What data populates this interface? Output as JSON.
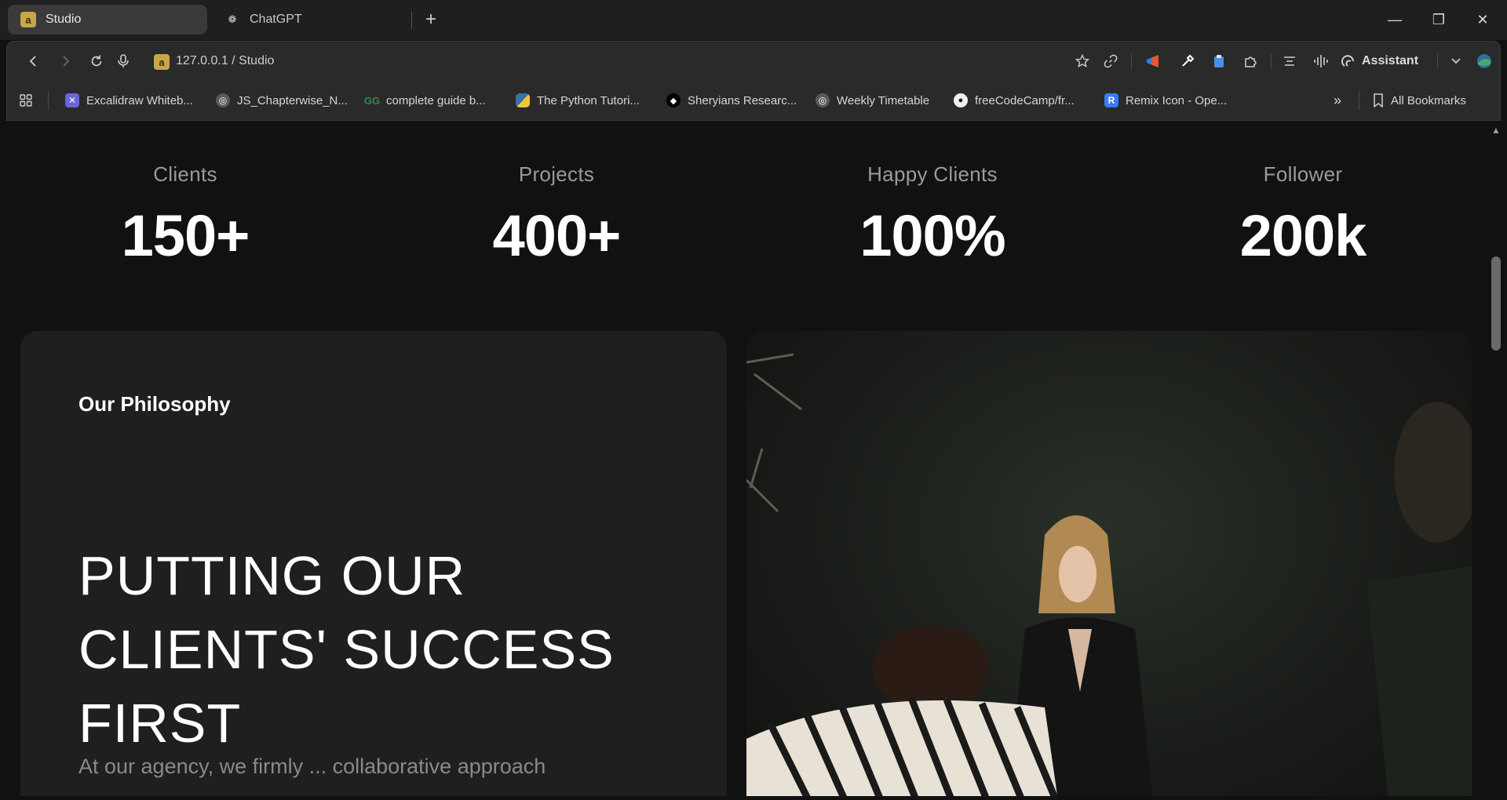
{
  "browser": {
    "tabs": [
      {
        "title": "Studio",
        "favicon": "a",
        "active": true
      },
      {
        "title": "ChatGPT",
        "favicon": "openai-icon",
        "active": false
      }
    ],
    "address": "127.0.0.1 / Studio",
    "address_favicon": "a",
    "assistant_label": "Assistant",
    "bookmarks": [
      {
        "label": "Excalidraw Whiteb...",
        "icon": "excalidraw-icon",
        "color": "#6965db"
      },
      {
        "label": "JS_Chapterwise_N...",
        "icon": "globe-icon",
        "color": "#5a5a5a"
      },
      {
        "label": "complete guide b...",
        "icon": "gfg-icon",
        "color": "#2f8d46"
      },
      {
        "label": "The Python Tutori...",
        "icon": "python-icon",
        "color": "#3572a5"
      },
      {
        "label": "Sheryians Researc...",
        "icon": "sheryians-icon",
        "color": "#000000"
      },
      {
        "label": "Weekly Timetable",
        "icon": "globe-icon",
        "color": "#5a5a5a"
      },
      {
        "label": "freeCodeCamp/fr...",
        "icon": "github-icon",
        "color": "#000000"
      },
      {
        "label": "Remix Icon - Ope...",
        "icon": "remix-icon",
        "color": "#3a7bfd"
      }
    ],
    "all_bookmarks_label": "All Bookmarks"
  },
  "stats": [
    {
      "label": "Clients",
      "value": "150+"
    },
    {
      "label": "Projects",
      "value": "400+"
    },
    {
      "label": "Happy Clients",
      "value": "100%"
    },
    {
      "label": "Follower",
      "value": "200k"
    }
  ],
  "philosophy": {
    "eyebrow": "Our Philosophy",
    "headline": "PUTTING OUR CLIENTS' SUCCESS FIRST",
    "body": "At our agency, we firmly ... collaborative approach"
  },
  "colors": {
    "page_bg": "#111111",
    "card_bg": "#1f1f1f",
    "accent_favicon": "#c9a64a"
  }
}
